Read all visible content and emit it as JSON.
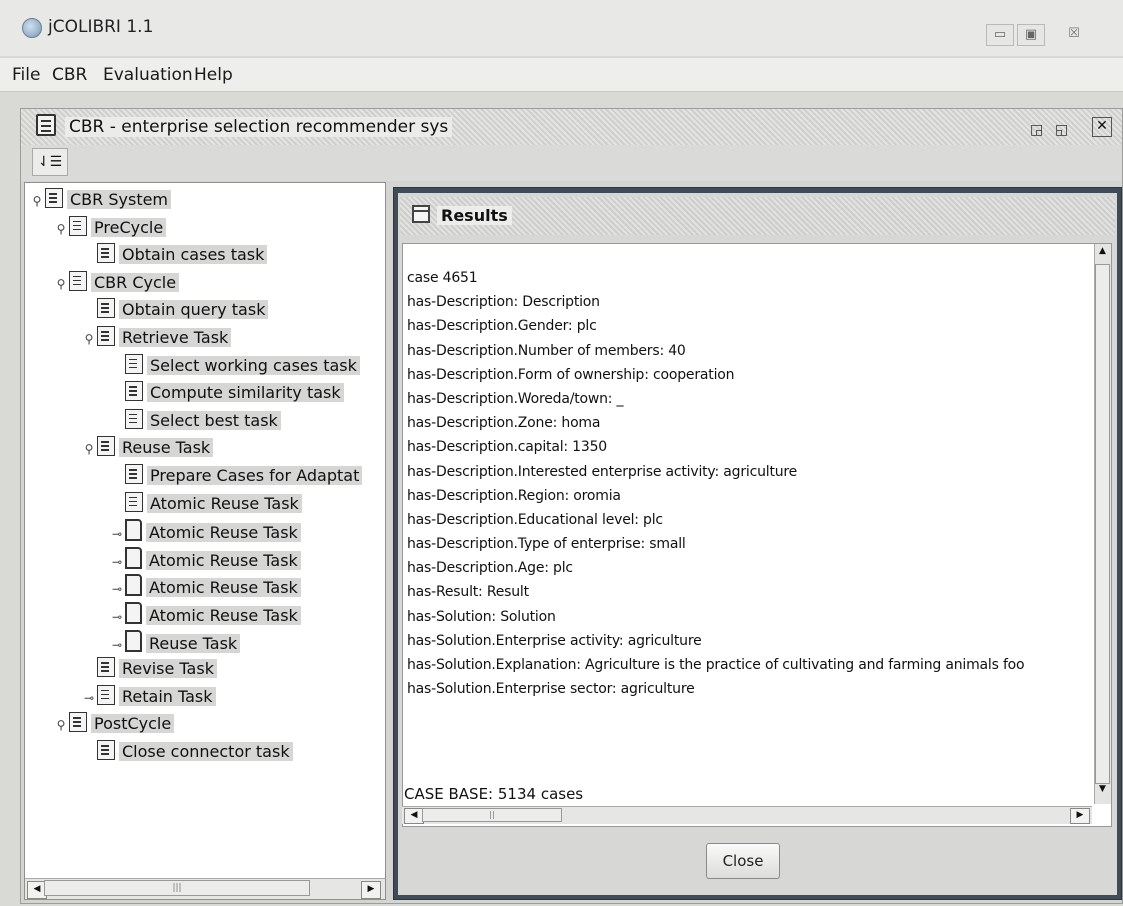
{
  "window": {
    "title": "jCOLIBRI 1.1",
    "min_glyph": "▭",
    "max_glyph": "▣",
    "close_glyph": "☒"
  },
  "menu": [
    "File",
    "CBR",
    "Evaluation",
    "Help"
  ],
  "frame": {
    "title": "CBR - enterprise selection recommender sys"
  },
  "tree": [
    {
      "label": "CBR System",
      "icon": "task-list-icon",
      "depth": 0,
      "handle": "open"
    },
    {
      "label": "PreCycle",
      "icon": "task-list-icon",
      "depth": 1,
      "handle": "open"
    },
    {
      "label": "Obtain cases task",
      "icon": "task-list-icon",
      "depth": 2,
      "handle": "none"
    },
    {
      "label": "CBR Cycle",
      "icon": "task-list-icon",
      "depth": 1,
      "handle": "open"
    },
    {
      "label": "Obtain query task",
      "icon": "task-list-icon",
      "depth": 2,
      "handle": "none"
    },
    {
      "label": "Retrieve Task",
      "icon": "task-list-icon",
      "depth": 2,
      "handle": "open"
    },
    {
      "label": "Select working cases task",
      "icon": "task-list-icon",
      "depth": 3,
      "handle": "none"
    },
    {
      "label": "Compute similarity task",
      "icon": "task-list-icon",
      "depth": 3,
      "handle": "none"
    },
    {
      "label": "Select best task",
      "icon": "task-list-icon",
      "depth": 3,
      "handle": "none"
    },
    {
      "label": "Reuse Task",
      "icon": "task-list-icon",
      "depth": 2,
      "handle": "open"
    },
    {
      "label": "Prepare Cases for Adaptat",
      "icon": "task-list-icon",
      "depth": 3,
      "handle": "none"
    },
    {
      "label": "Atomic Reuse Task",
      "icon": "task-list-icon",
      "depth": 3,
      "handle": "none"
    },
    {
      "label": "Atomic Reuse Task",
      "icon": "document-icon",
      "depth": 3,
      "handle": "closed"
    },
    {
      "label": "Atomic Reuse Task",
      "icon": "document-icon",
      "depth": 3,
      "handle": "closed"
    },
    {
      "label": "Atomic Reuse Task",
      "icon": "document-icon",
      "depth": 3,
      "handle": "closed"
    },
    {
      "label": "Atomic Reuse Task",
      "icon": "document-icon",
      "depth": 3,
      "handle": "closed"
    },
    {
      "label": "Reuse Task",
      "icon": "document-icon",
      "depth": 3,
      "handle": "closed"
    },
    {
      "label": "Revise Task",
      "icon": "task-list-icon",
      "depth": 2,
      "handle": "none"
    },
    {
      "label": "Retain Task",
      "icon": "task-list-icon",
      "depth": 2,
      "handle": "closed"
    },
    {
      "label": "PostCycle",
      "icon": "task-list-icon",
      "depth": 1,
      "handle": "open"
    },
    {
      "label": "Close connector task",
      "icon": "task-list-icon",
      "depth": 2,
      "handle": "none"
    }
  ],
  "results": {
    "title": "Results",
    "lines": [
      "case 4651",
      "has-Description: Description",
      "has-Description.Gender: plc",
      "has-Description.Number of members: 40",
      "has-Description.Form of ownership: cooperation",
      "has-Description.Woreda/town: _",
      "has-Description.Zone: homa",
      "has-Description.capital: 1350",
      "has-Description.Interested enterprise activity: agriculture",
      "has-Description.Region: oromia",
      "has-Description.Educational level: plc",
      "has-Description.Type of enterprise: small",
      "has-Description.Age: plc",
      "has-Result: Result",
      "has-Solution: Solution",
      "has-Solution.Enterprise activity: agriculture",
      "has-Solution.Explanation: Agriculture is the practice of cultivating and farming animals foo",
      "has-Solution.Enterprise sector: agriculture"
    ],
    "case_base": "CASE BASE: 5134 cases",
    "close_label": "Close"
  }
}
